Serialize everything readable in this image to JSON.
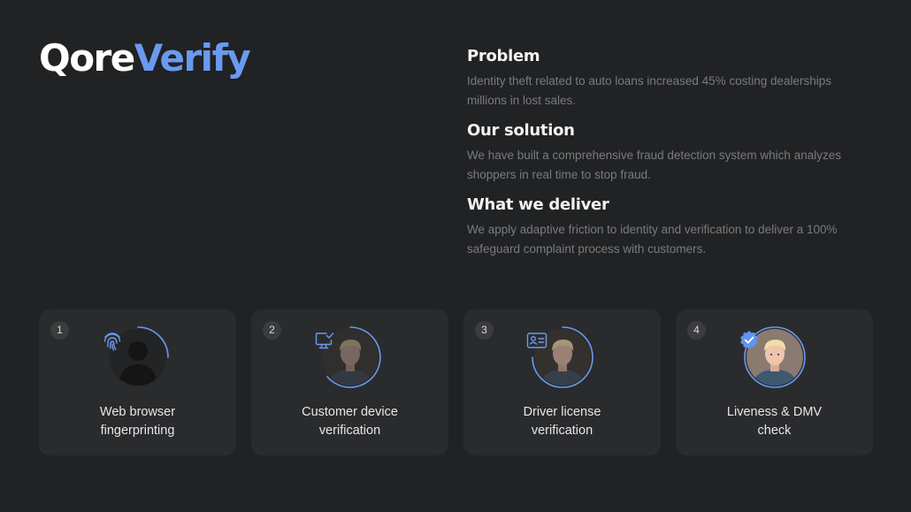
{
  "brand": {
    "part1": "Qore",
    "part2": "Verify"
  },
  "sections": [
    {
      "heading": "Problem",
      "body": "Identity theft related to auto loans increased 45% costing dealerships millions in lost sales."
    },
    {
      "heading": "Our solution",
      "body": "We have built a comprehensive fraud detection system which analyzes shoppers in real time to stop fraud."
    },
    {
      "heading": "What we deliver",
      "body": "We apply adaptive friction to identity and verification to deliver a 100% safeguard complaint process with customers."
    }
  ],
  "steps": [
    {
      "number": "1",
      "label": "Web browser fingerprinting",
      "icon": "fingerprint-icon"
    },
    {
      "number": "2",
      "label": "Customer device verification",
      "icon": "monitor-check-icon"
    },
    {
      "number": "3",
      "label": "Driver license verification",
      "icon": "id-card-icon"
    },
    {
      "number": "4",
      "label": "Liveness & DMV check",
      "icon": "verified-badge-icon"
    }
  ],
  "colors": {
    "accent": "#6a9af0",
    "background": "#212223",
    "card": "#2a2b2d",
    "muted_text": "#7a7b7d"
  }
}
